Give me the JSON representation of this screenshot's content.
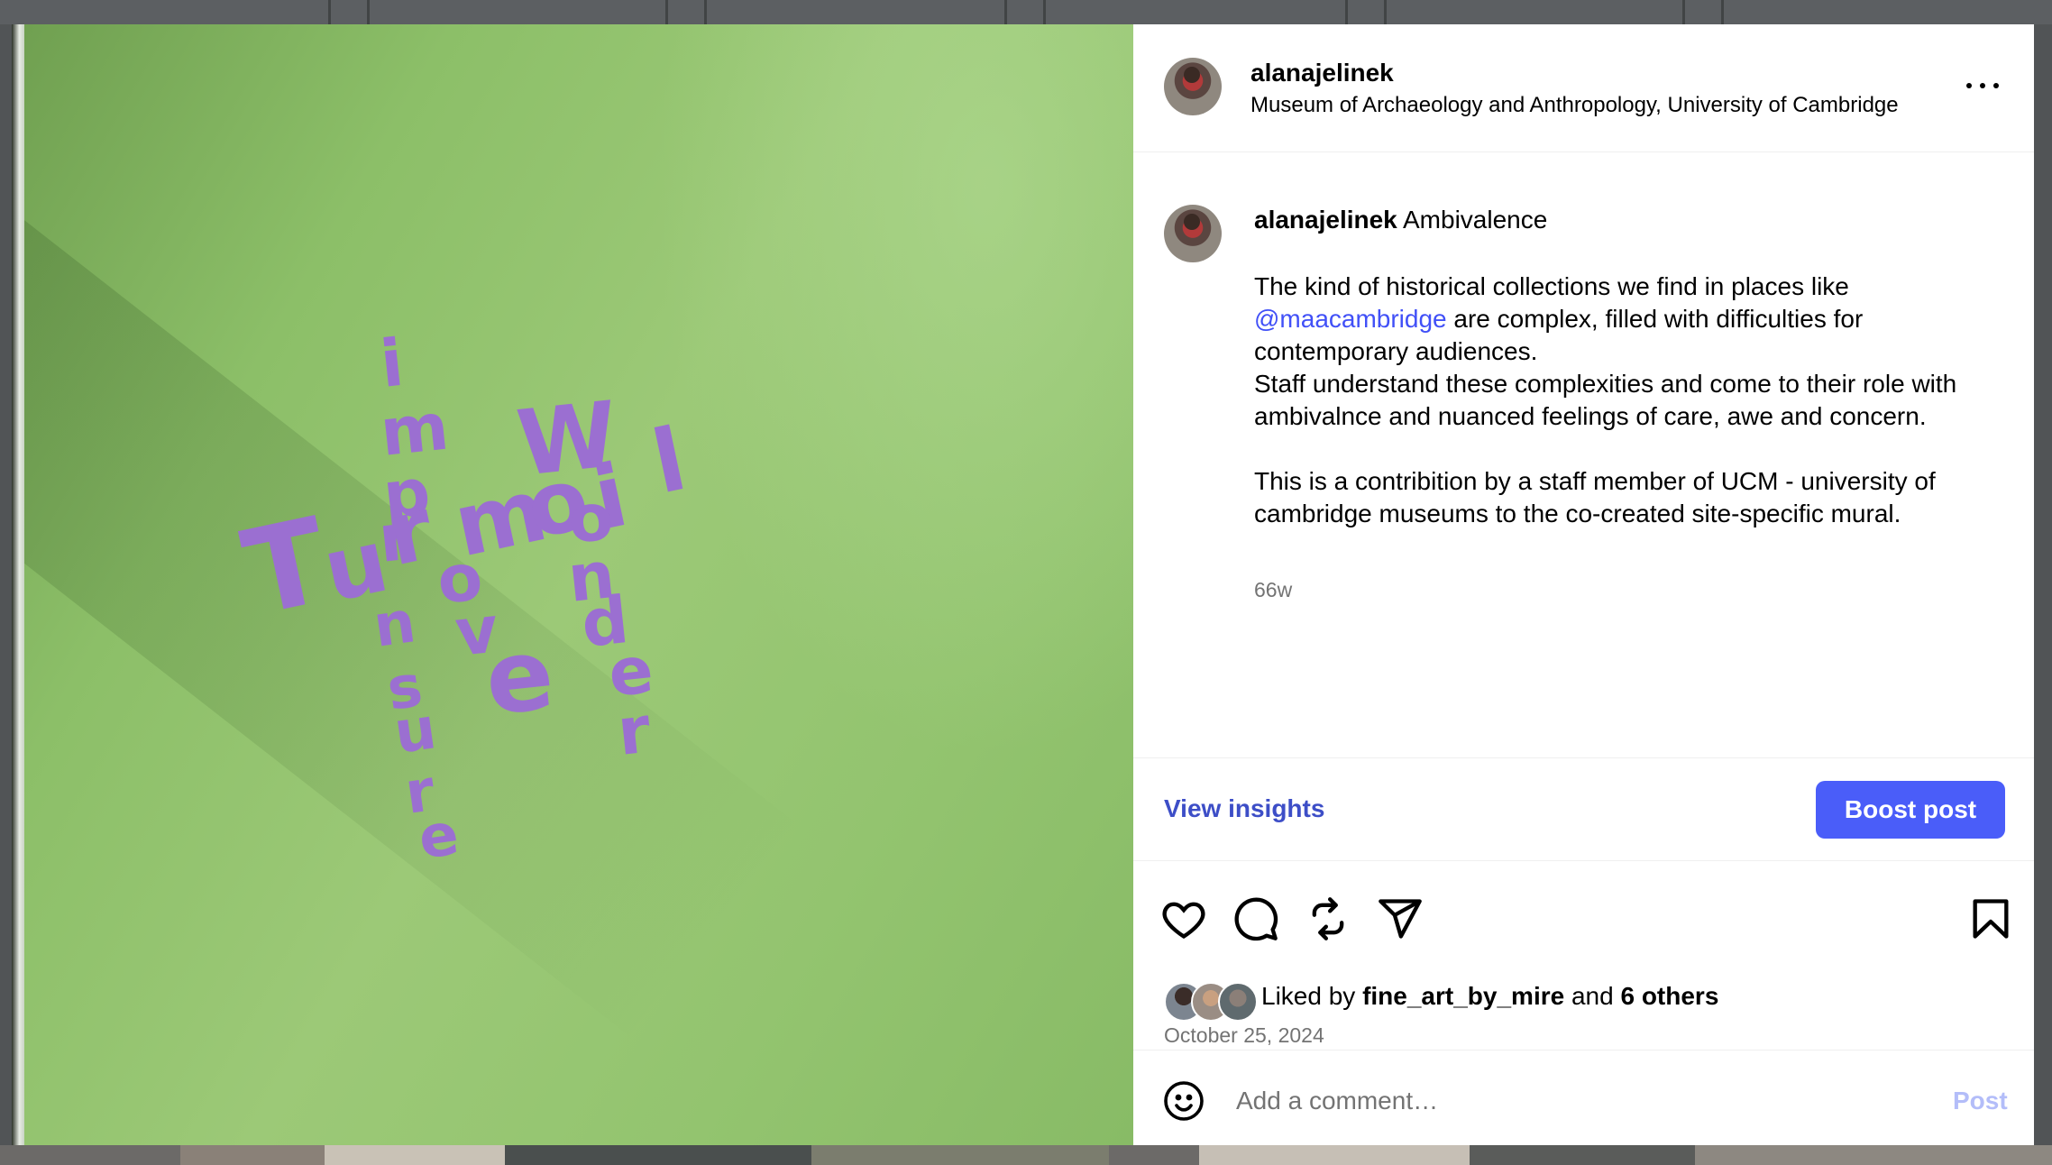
{
  "post": {
    "username": "alanajelinek",
    "location": "Museum of Archaeology and Anthropology, University of Cambridge",
    "caption": {
      "username": "alanajelinek",
      "title": "Ambivalence",
      "line1": "The kind of historical collections we find in places like",
      "mention": "@maacambridge",
      "line2_rest": " are complex, filled with difficulties for contemporary audiences.",
      "para2": "Staff understand these complexities and come to their role with ambivalnce and nuanced feelings of care, awe and concern.",
      "para3": "This is a contribition by a staff member of UCM - university of cambridge museums to the co-created site-specific mural."
    },
    "time_ago": "66w",
    "likes": {
      "prefix": "Liked by",
      "user": "fine_art_by_mire",
      "and": "and",
      "others": "6 others"
    },
    "date": "October 25, 2024"
  },
  "mural": {
    "letters_vertical_left": [
      "i",
      "m",
      "p",
      "r",
      "o",
      "v",
      "e"
    ],
    "word_horizontal": "Turmoil",
    "letters_vertical_inner": [
      "n",
      "s",
      "u",
      "r",
      "e"
    ],
    "letters_wonder": [
      "W",
      "o",
      "n",
      "d",
      "e",
      "r"
    ]
  },
  "actions": {
    "view_insights": "View insights",
    "boost_post": "Boost post",
    "like_icon": "heart-icon",
    "comment_icon": "comment-icon",
    "repost_icon": "repost-icon",
    "share_icon": "send-icon",
    "save_icon": "bookmark-icon"
  },
  "comment": {
    "placeholder": "Add a comment…",
    "post_label": "Post"
  },
  "colors": {
    "mention": "#4150f7",
    "boost_button": "#4a5df9",
    "mural_ink": "#9b6fd1",
    "wall_green": "#93c46f"
  }
}
